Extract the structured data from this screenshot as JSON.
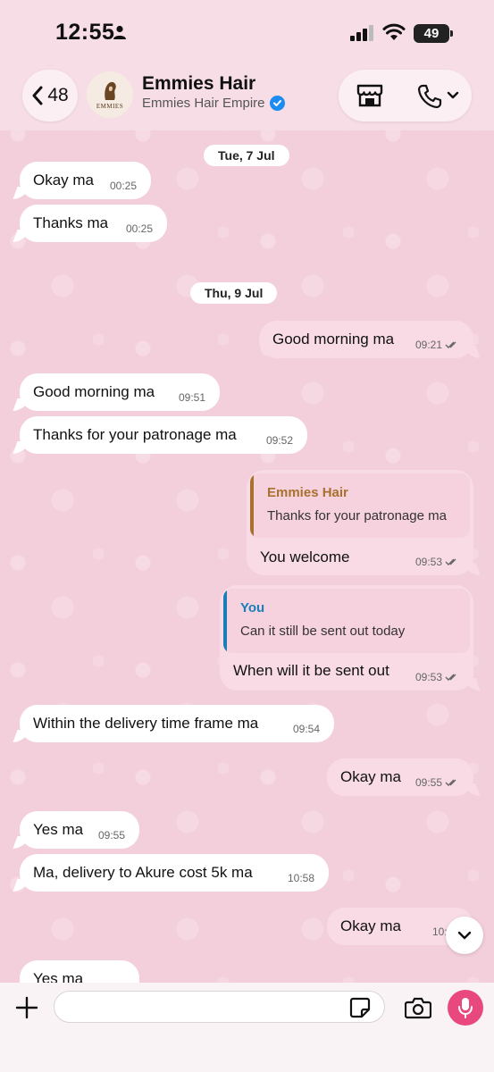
{
  "status_bar": {
    "time": "12:55",
    "battery": "49"
  },
  "header": {
    "back_count": "48",
    "avatar_text": "EMMIES",
    "contact_name": "Emmies Hair",
    "contact_sub": "Emmies Hair Empire"
  },
  "dates": [
    "Tue, 7 Jul",
    "Thu, 9 Jul"
  ],
  "messages": [
    {
      "dir": "in",
      "text": "Okay ma",
      "time": "00:25"
    },
    {
      "dir": "in",
      "text": "Thanks ma",
      "time": "00:25"
    },
    {
      "dir": "out",
      "text": "Good morning ma",
      "time": "09:21"
    },
    {
      "dir": "in",
      "text": "Good morning ma",
      "time": "09:51"
    },
    {
      "dir": "in",
      "text": "Thanks for your patronage ma",
      "time": "09:52"
    },
    {
      "dir": "out",
      "text": "You welcome",
      "time": "09:53",
      "quote": {
        "author": "Emmies Hair",
        "text": "Thanks for your patronage ma",
        "color": "#a9712e"
      }
    },
    {
      "dir": "out",
      "text": "When will it be sent out",
      "time": "09:53",
      "quote": {
        "author": "You",
        "text": "Can it still be sent out today",
        "color": "#1a7fb8"
      }
    },
    {
      "dir": "in",
      "text": "Within the delivery time frame ma",
      "time": "09:54"
    },
    {
      "dir": "out",
      "text": "Okay ma",
      "time": "09:55"
    },
    {
      "dir": "in",
      "text": "Yes ma",
      "time": "09:55"
    },
    {
      "dir": "in",
      "text": "Ma, delivery to Akure cost 5k ma",
      "time": "10:58"
    },
    {
      "dir": "out",
      "text": "Okay ma",
      "time": "10:58"
    },
    {
      "dir": "in",
      "text": "Yes ma",
      "time": ""
    }
  ],
  "colors": {
    "mic": "#e8487e",
    "verified": "#1d8cf0",
    "chat_bg": "#f3cfdc"
  }
}
